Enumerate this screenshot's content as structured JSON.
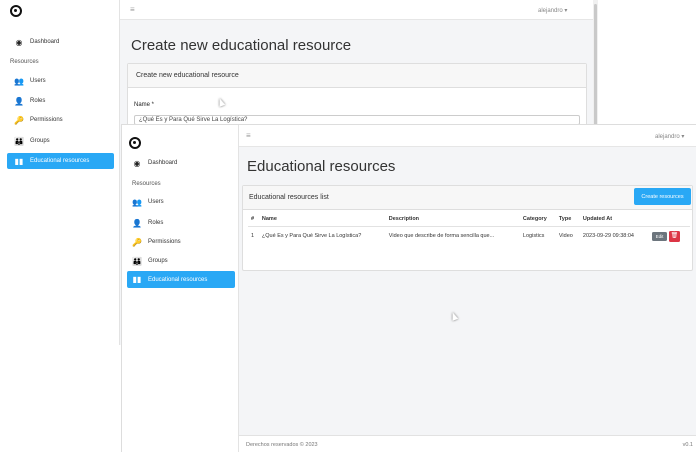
{
  "back": {
    "nav": {
      "dashboard": "Dashboard",
      "section": "Resources",
      "users": "Users",
      "roles": "Roles",
      "permissions": "Permissions",
      "groups": "Groups",
      "educational": "Educational resources"
    },
    "topbar": {
      "hamburger": "≡",
      "user": "alejandro ▾"
    },
    "title": "Create new educational resource",
    "card_header": "Create new educational resource",
    "name_label": "Name *",
    "name_value": "¿Qué Es y Para Qué Sirve La Logística?"
  },
  "front": {
    "nav": {
      "dashboard": "Dashboard",
      "section": "Resources",
      "users": "Users",
      "roles": "Roles",
      "permissions": "Permissions",
      "groups": "Groups",
      "educational": "Educational resources"
    },
    "topbar": {
      "hamburger": "≡",
      "user": "alejandro ▾"
    },
    "title": "Educational resources",
    "card_header": "Educational resources list",
    "create_button": "Create resources",
    "table": {
      "headers": [
        "#",
        "Name",
        "Description",
        "Category",
        "Type",
        "Updated At"
      ],
      "rows": [
        {
          "num": "1",
          "name": "¿Qué Es y Para Qué Sirve La Logística?",
          "description": "Video que describe de forma sencilla que...",
          "category": "Logistics",
          "type": "Video",
          "updated": "2023-09-29 09:38:04",
          "edit": "Edit",
          "delete": "🗑"
        }
      ]
    },
    "footer": {
      "left": "Derechos reservados © 2023",
      "right": "v0.1"
    }
  },
  "icons": {
    "dashboard": "dashboard-icon",
    "users": "users-icon",
    "roles": "roles-icon",
    "permissions": "key-icon",
    "groups": "groups-icon",
    "educational": "book-icon"
  },
  "colors": {
    "accent": "#29a8f5",
    "danger": "#dc3545",
    "secondary": "#6c757d"
  }
}
